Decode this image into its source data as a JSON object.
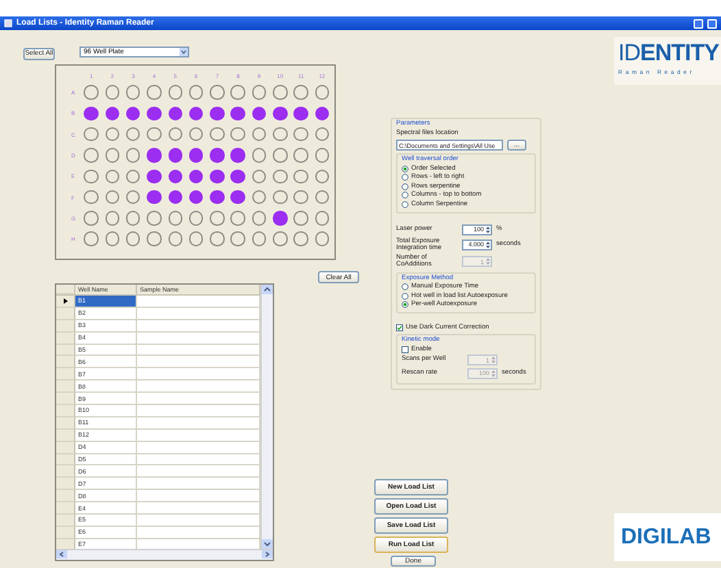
{
  "window": {
    "title": "Load Lists - Identity Raman Reader"
  },
  "toolbar": {
    "select_all": "Select All",
    "plate_type": "96 Well Plate"
  },
  "plate": {
    "columns": [
      "1",
      "2",
      "3",
      "4",
      "5",
      "6",
      "7",
      "8",
      "9",
      "10",
      "11",
      "12"
    ],
    "rows": [
      {
        "label": "A",
        "wells": [
          {
            "selected": false
          },
          {
            "selected": false
          },
          {
            "selected": false
          },
          {
            "selected": false
          },
          {
            "selected": false
          },
          {
            "selected": false
          },
          {
            "selected": false
          },
          {
            "selected": false
          },
          {
            "selected": false
          },
          {
            "selected": false
          },
          {
            "selected": false
          },
          {
            "selected": false
          }
        ]
      },
      {
        "label": "B",
        "wells": [
          {
            "selected": true
          },
          {
            "selected": true
          },
          {
            "selected": true
          },
          {
            "selected": true
          },
          {
            "selected": true
          },
          {
            "selected": true
          },
          {
            "selected": true
          },
          {
            "selected": true
          },
          {
            "selected": true
          },
          {
            "selected": true
          },
          {
            "selected": true
          },
          {
            "selected": true
          }
        ]
      },
      {
        "label": "C",
        "wells": [
          {
            "selected": false
          },
          {
            "selected": false
          },
          {
            "selected": false
          },
          {
            "selected": false
          },
          {
            "selected": false
          },
          {
            "selected": false
          },
          {
            "selected": false
          },
          {
            "selected": false
          },
          {
            "selected": false
          },
          {
            "selected": false
          },
          {
            "selected": false
          },
          {
            "selected": false
          }
        ]
      },
      {
        "label": "D",
        "wells": [
          {
            "selected": false
          },
          {
            "selected": false
          },
          {
            "selected": false
          },
          {
            "selected": true
          },
          {
            "selected": true
          },
          {
            "selected": true
          },
          {
            "selected": true
          },
          {
            "selected": true
          },
          {
            "selected": false
          },
          {
            "selected": false
          },
          {
            "selected": false
          },
          {
            "selected": false
          }
        ]
      },
      {
        "label": "E",
        "wells": [
          {
            "selected": false
          },
          {
            "selected": false
          },
          {
            "selected": false
          },
          {
            "selected": true
          },
          {
            "selected": true
          },
          {
            "selected": true
          },
          {
            "selected": true
          },
          {
            "selected": true
          },
          {
            "selected": false
          },
          {
            "selected": false
          },
          {
            "selected": false
          },
          {
            "selected": false
          }
        ]
      },
      {
        "label": "F",
        "wells": [
          {
            "selected": false
          },
          {
            "selected": false
          },
          {
            "selected": false
          },
          {
            "selected": true
          },
          {
            "selected": true
          },
          {
            "selected": true
          },
          {
            "selected": true
          },
          {
            "selected": true
          },
          {
            "selected": false
          },
          {
            "selected": false
          },
          {
            "selected": false
          },
          {
            "selected": false
          }
        ]
      },
      {
        "label": "G",
        "wells": [
          {
            "selected": false
          },
          {
            "selected": false
          },
          {
            "selected": false
          },
          {
            "selected": false
          },
          {
            "selected": false
          },
          {
            "selected": false
          },
          {
            "selected": false
          },
          {
            "selected": false
          },
          {
            "selected": false
          },
          {
            "selected": true
          },
          {
            "selected": false
          },
          {
            "selected": false
          }
        ]
      },
      {
        "label": "H",
        "wells": [
          {
            "selected": false
          },
          {
            "selected": false
          },
          {
            "selected": false
          },
          {
            "selected": false
          },
          {
            "selected": false
          },
          {
            "selected": false
          },
          {
            "selected": false
          },
          {
            "selected": false
          },
          {
            "selected": false
          },
          {
            "selected": false
          },
          {
            "selected": false
          },
          {
            "selected": false
          }
        ]
      }
    ]
  },
  "clear_all": "Clear All",
  "table": {
    "columns": [
      "Well Name",
      "Sample Name"
    ],
    "rows": [
      {
        "well_name": "B1",
        "selected": true
      },
      {
        "well_name": "B2",
        "selected": false
      },
      {
        "well_name": "B3",
        "selected": false
      },
      {
        "well_name": "B4",
        "selected": false
      },
      {
        "well_name": "B5",
        "selected": false
      },
      {
        "well_name": "B6",
        "selected": false
      },
      {
        "well_name": "B7",
        "selected": false
      },
      {
        "well_name": "B8",
        "selected": false
      },
      {
        "well_name": "B9",
        "selected": false
      },
      {
        "well_name": "B10",
        "selected": false
      },
      {
        "well_name": "B11",
        "selected": false
      },
      {
        "well_name": "B12",
        "selected": false
      },
      {
        "well_name": "D4",
        "selected": false
      },
      {
        "well_name": "D5",
        "selected": false
      },
      {
        "well_name": "D6",
        "selected": false
      },
      {
        "well_name": "D7",
        "selected": false
      },
      {
        "well_name": "D8",
        "selected": false
      },
      {
        "well_name": "E4",
        "selected": false
      },
      {
        "well_name": "E5",
        "selected": false
      },
      {
        "well_name": "E6",
        "selected": false
      },
      {
        "well_name": "E7",
        "selected": false
      }
    ]
  },
  "parameters": {
    "title": "Parameters",
    "files_label": "Spectral files location",
    "files_value": "C:\\Documents and Settings\\All Use",
    "browse": "...",
    "traversal": {
      "title": "Well traversal order",
      "options": [
        {
          "label": "Order Selected",
          "selected": true
        },
        {
          "label": "Rows - left to right",
          "selected": false
        },
        {
          "label": "Rows serpentine",
          "selected": false
        },
        {
          "label": "Columns - top to bottom",
          "selected": false
        },
        {
          "label": "Column Serpentine",
          "selected": false
        }
      ]
    },
    "laser": {
      "label": "Laser power",
      "value": "100",
      "unit": "%",
      "disabled": false
    },
    "exposure": {
      "label": "Total Exposure Integration time",
      "value": "4.000",
      "unit": "seconds",
      "disabled": false
    },
    "coadditions": {
      "label": "Number of CoAdditions",
      "value": "1",
      "disabled": true
    },
    "method": {
      "title": "Exposure Method",
      "options": [
        {
          "label": "Manual Exposure Time",
          "selected": false
        },
        {
          "label": "Hot well in load list Autoexposure",
          "selected": false
        },
        {
          "label": "Per-well Autoexposure",
          "selected": true
        }
      ]
    },
    "dark_current": {
      "label": "Use Dark Current Correction",
      "checked": true
    },
    "kinetic": {
      "title": "Kinetic mode",
      "enable": {
        "label": "Enable",
        "checked": false
      },
      "scans": {
        "label": "Scans per Well",
        "value": "1",
        "disabled": true
      },
      "rescan": {
        "label": "Rescan rate",
        "value": "100",
        "unit": "seconds",
        "disabled": true
      }
    }
  },
  "buttons": [
    {
      "label": "New Load List",
      "default": false
    },
    {
      "label": "Open Load List",
      "default": false
    },
    {
      "label": "Save Load List",
      "default": false
    },
    {
      "label": "Run Load List",
      "default": true
    }
  ],
  "done": "Done",
  "logos": {
    "top": {
      "wordmark": "ID**ENTITY**",
      "tagline": "Raman Reader"
    },
    "bottom": {
      "wordmark": "DIGILAB"
    }
  }
}
